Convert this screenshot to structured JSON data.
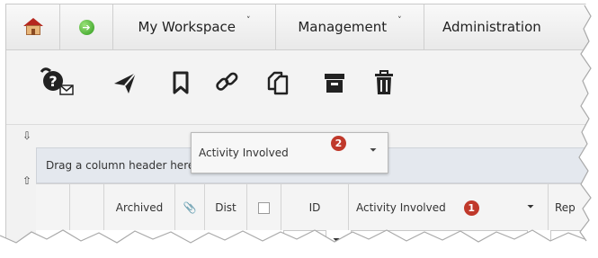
{
  "nav": {
    "items": [
      {
        "label": ""
      },
      {
        "label": ""
      },
      {
        "label": "My Workspace",
        "caret": "˅"
      },
      {
        "label": "Management",
        "caret": "˅"
      },
      {
        "label": "Administration"
      }
    ]
  },
  "toolbar": {
    "icons": [
      "help-email-icon",
      "send-icon",
      "bookmark-icon",
      "link-icon",
      "copy-icon",
      "archive-icon",
      "delete-icon"
    ]
  },
  "grid": {
    "group_panel_text": "Drag a column header here to group by that column",
    "drag_ghost": {
      "label": "Activity Involved",
      "badge": "2"
    },
    "columns": [
      {
        "label": ""
      },
      {
        "label": ""
      },
      {
        "label": "Archived"
      },
      {
        "label": "📎"
      },
      {
        "label": "Dist"
      },
      {
        "label": ""
      },
      {
        "label": "ID"
      },
      {
        "label": "Activity Involved",
        "badge": "1"
      },
      {
        "label": "Rep"
      }
    ]
  },
  "colors": {
    "badge": "#c0392b",
    "nav_bg": "#eeeeee",
    "group_panel": "#e4e8ee"
  }
}
